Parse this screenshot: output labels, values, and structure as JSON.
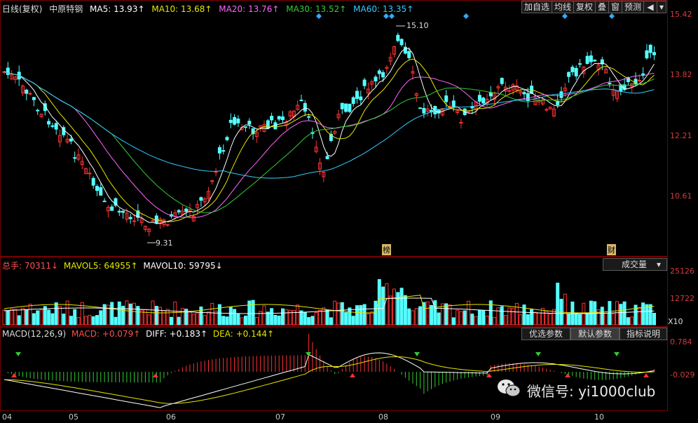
{
  "header": {
    "period": "日线(复权)",
    "stock_name": "中原特钢",
    "ma": [
      {
        "label": "MA5: 13.93↑",
        "color": "#ffffff"
      },
      {
        "label": "MA10: 13.68↑",
        "color": "#e6e600"
      },
      {
        "label": "MA20: 13.76↑",
        "color": "#ff66ff"
      },
      {
        "label": "MA30: 13.52↑",
        "color": "#33cc33"
      },
      {
        "label": "MA60: 13.35↑",
        "color": "#33ccff"
      }
    ],
    "buttons": [
      "加自选",
      "均线",
      "复权",
      "叠",
      "窗",
      "预测"
    ]
  },
  "price_axis": [
    "15.42",
    "13.82",
    "12.21",
    "10.61"
  ],
  "annotations": {
    "high": "15.10",
    "low": "9.31",
    "tag1": "榜",
    "tag2": "财"
  },
  "volume": {
    "label": "总手: 70311↓",
    "mavol5": "MAVOL5: 64955↑",
    "mavol10": "MAVOL10: 59795↓",
    "dropdown": "成交量",
    "axis": [
      "25126",
      "12722",
      "X10"
    ]
  },
  "macd": {
    "title": "MACD(12,26,9)",
    "macd": "MACD: +0.079↑",
    "diff": "DIFF: +0.183↑",
    "dea": "DEA: +0.144↑",
    "buttons": [
      "优选参数",
      "默认参数",
      "指标说明"
    ],
    "axis": [
      "0.784",
      "-0.029"
    ]
  },
  "months": [
    "04",
    "05",
    "06",
    "07",
    "08",
    "09",
    "10"
  ],
  "watermark": "微信号: yi1000club",
  "colors": {
    "up": "#ff3232",
    "down": "#54ffff",
    "border": "#7a0000"
  }
}
